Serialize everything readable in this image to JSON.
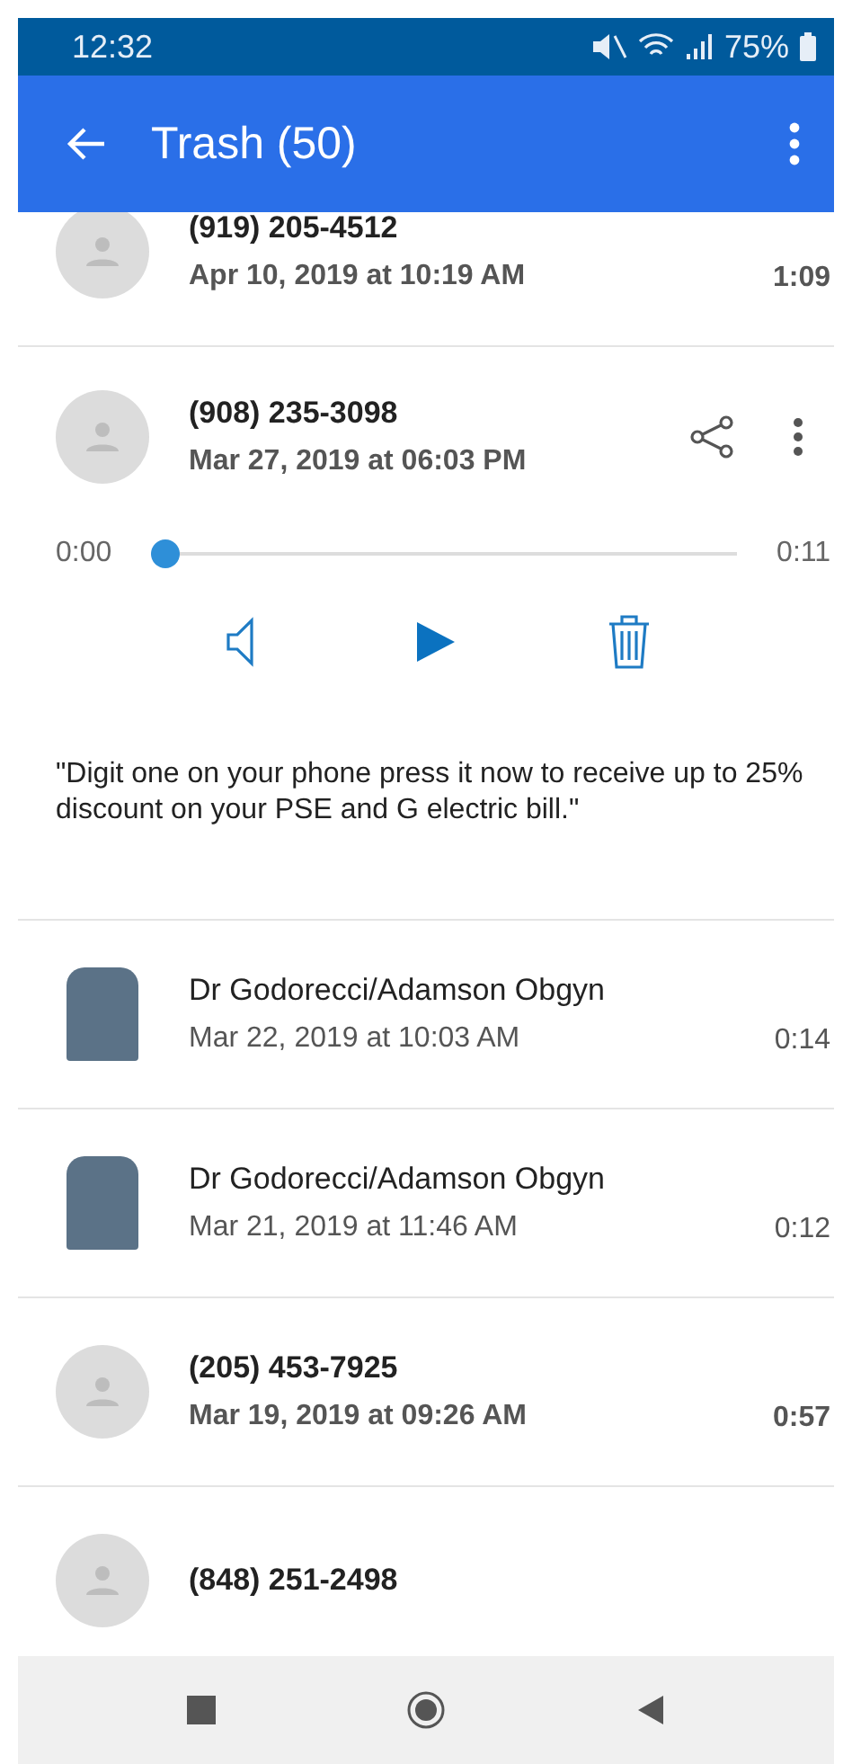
{
  "status_bar": {
    "time": "12:32",
    "battery": "75%"
  },
  "app_bar": {
    "title": "Trash (50)"
  },
  "calls": [
    {
      "kind": "placeholder",
      "name": "(919) 205-4512",
      "date": "Apr 10, 2019 at 10:19 AM",
      "duration": "1:09",
      "unread": true,
      "expanded": false
    },
    {
      "kind": "placeholder",
      "name": "(908) 235-3098",
      "date": "Mar 27, 2019 at 06:03 PM",
      "unread": true,
      "expanded": true,
      "player": {
        "elapsed": "0:00",
        "total": "0:11",
        "level": 0
      },
      "transcript": "\"Digit one on your phone press it now to receive up to 25% discount on your PSE and G electric bill.\""
    },
    {
      "kind": "photo",
      "name": "Dr Godorecci/Adamson Obgyn",
      "date": "Mar 22, 2019 at 10:03 AM",
      "duration": "0:14",
      "unread": false,
      "expanded": false
    },
    {
      "kind": "photo",
      "name": "Dr Godorecci/Adamson Obgyn",
      "date": "Mar 21, 2019 at 11:46 AM",
      "duration": "0:12",
      "unread": false,
      "expanded": false
    },
    {
      "kind": "placeholder",
      "name": "(205) 453-7925",
      "date": "Mar 19, 2019 at 09:26 AM",
      "duration": "0:57",
      "unread": true,
      "expanded": false
    },
    {
      "kind": "placeholder",
      "name": "(848) 251-2498",
      "unread": true,
      "expanded": false
    }
  ]
}
